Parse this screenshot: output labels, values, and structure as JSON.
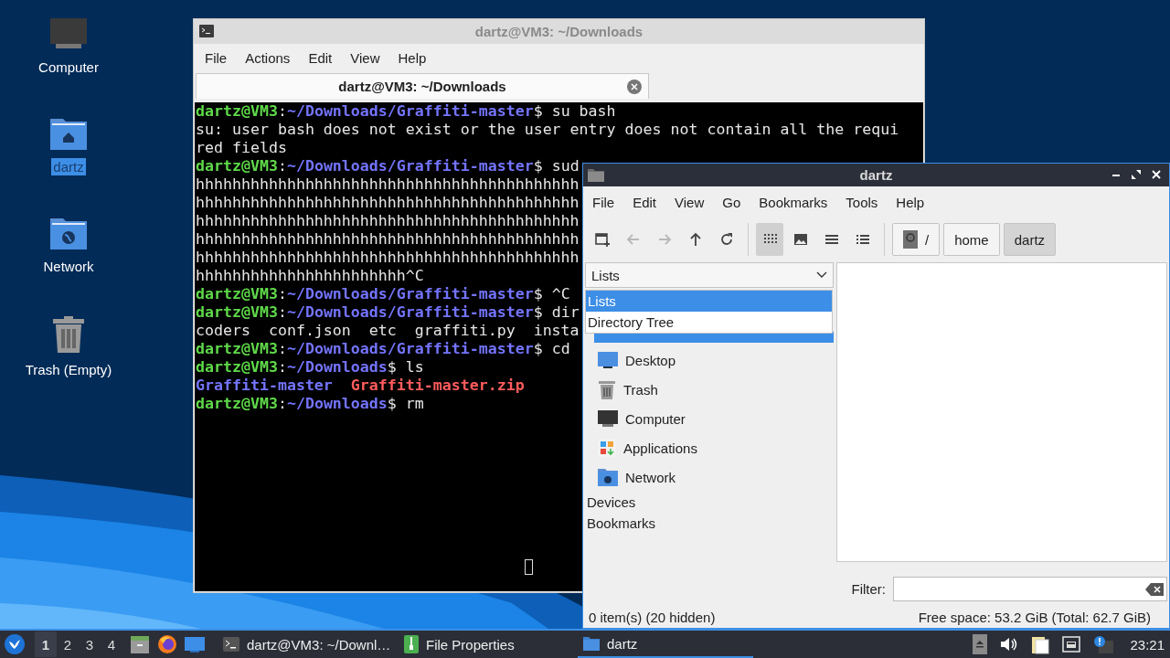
{
  "desktop_icons": [
    {
      "label": "Computer",
      "kind": "computer",
      "selected": false
    },
    {
      "label": "dartz",
      "kind": "home",
      "selected": true
    },
    {
      "label": "Network",
      "kind": "network",
      "selected": false
    },
    {
      "label": "Trash (Empty)",
      "kind": "trash",
      "selected": false
    }
  ],
  "terminal": {
    "title": "dartz@VM3: ~/Downloads",
    "active": false,
    "menu": [
      "File",
      "Actions",
      "Edit",
      "View",
      "Help"
    ],
    "tab": {
      "label": "dartz@VM3: ~/Downloads"
    },
    "lines": [
      {
        "segments": [
          {
            "kind": "user",
            "text": "dartz@VM3"
          },
          {
            "kind": "plain",
            "text": ":"
          },
          {
            "kind": "path",
            "text": "~/Downloads/Graffiti-master"
          },
          {
            "kind": "plain",
            "text": "$ su bash"
          }
        ]
      },
      {
        "segments": [
          {
            "kind": "plain",
            "text": "su: user bash does not exist or the user entry does not contain all the requi"
          }
        ]
      },
      {
        "segments": [
          {
            "kind": "plain",
            "text": "red fields"
          }
        ]
      },
      {
        "segments": [
          {
            "kind": "user",
            "text": "dartz@VM3"
          },
          {
            "kind": "plain",
            "text": ":"
          },
          {
            "kind": "path",
            "text": "~/Downloads/Graffiti-master"
          },
          {
            "kind": "plain",
            "text": "$ sud"
          }
        ]
      },
      {
        "segments": [
          {
            "kind": "plain",
            "text": "hhhhhhhhhhhhhhhhhhhhhhhhhhhhhhhhhhhhhhhhhh"
          }
        ]
      },
      {
        "segments": [
          {
            "kind": "plain",
            "text": "hhhhhhhhhhhhhhhhhhhhhhhhhhhhhhhhhhhhhhhhhh"
          }
        ]
      },
      {
        "segments": [
          {
            "kind": "plain",
            "text": "hhhhhhhhhhhhhhhhhhhhhhhhhhhhhhhhhhhhhhhhhh"
          }
        ]
      },
      {
        "segments": [
          {
            "kind": "plain",
            "text": "hhhhhhhhhhhhhhhhhhhhhhhhhhhhhhhhhhhhhhhhhh"
          }
        ]
      },
      {
        "segments": [
          {
            "kind": "plain",
            "text": "hhhhhhhhhhhhhhhhhhhhhhhhhhhhhhhhhhhhhhhhhh"
          }
        ]
      },
      {
        "segments": [
          {
            "kind": "plain",
            "text": "hhhhhhhhhhhhhhhhhhhhhhh^C"
          }
        ]
      },
      {
        "segments": [
          {
            "kind": "user",
            "text": "dartz@VM3"
          },
          {
            "kind": "plain",
            "text": ":"
          },
          {
            "kind": "path",
            "text": "~/Downloads/Graffiti-master"
          },
          {
            "kind": "plain",
            "text": "$ ^C"
          }
        ]
      },
      {
        "segments": [
          {
            "kind": "user",
            "text": "dartz@VM3"
          },
          {
            "kind": "plain",
            "text": ":"
          },
          {
            "kind": "path",
            "text": "~/Downloads/Graffiti-master"
          },
          {
            "kind": "plain",
            "text": "$ dir"
          }
        ]
      },
      {
        "segments": [
          {
            "kind": "plain",
            "text": "coders  conf.json  etc  graffiti.py  insta"
          }
        ]
      },
      {
        "segments": [
          {
            "kind": "user",
            "text": "dartz@VM3"
          },
          {
            "kind": "plain",
            "text": ":"
          },
          {
            "kind": "path",
            "text": "~/Downloads/Graffiti-master"
          },
          {
            "kind": "plain",
            "text": "$ cd"
          }
        ]
      },
      {
        "segments": [
          {
            "kind": "user",
            "text": "dartz@VM3"
          },
          {
            "kind": "plain",
            "text": ":"
          },
          {
            "kind": "path",
            "text": "~/Downloads"
          },
          {
            "kind": "plain",
            "text": "$ ls"
          }
        ]
      },
      {
        "segments": [
          {
            "kind": "directory",
            "text": "Graffiti-master"
          },
          {
            "kind": "archive",
            "text": "  Graffiti-master.zip"
          }
        ]
      },
      {
        "segments": [
          {
            "kind": "user",
            "text": "dartz@VM3"
          },
          {
            "kind": "plain",
            "text": ":"
          },
          {
            "kind": "path",
            "text": "~/Downloads"
          },
          {
            "kind": "plain",
            "text": "$ rm"
          }
        ]
      }
    ]
  },
  "file_manager": {
    "title": "dartz",
    "active": true,
    "menu": [
      "File",
      "Edit",
      "View",
      "Go",
      "Bookmarks",
      "Tools",
      "Help"
    ],
    "toolbar": [
      {
        "kind": "new-tab",
        "disabled": false
      },
      {
        "kind": "back",
        "disabled": true
      },
      {
        "kind": "forward",
        "disabled": true
      },
      {
        "kind": "up",
        "disabled": false
      },
      {
        "kind": "reload",
        "disabled": false
      }
    ],
    "view_modes": [
      {
        "kind": "icons",
        "selected": true
      },
      {
        "kind": "thumbnails",
        "selected": false
      },
      {
        "kind": "compact",
        "selected": false
      },
      {
        "kind": "details",
        "selected": false
      }
    ],
    "path_buttons": [
      {
        "kind": "root",
        "label": "/",
        "selected": false
      },
      {
        "kind": "folder",
        "label": "home",
        "selected": false
      },
      {
        "kind": "folder",
        "label": "dartz",
        "selected": true
      }
    ],
    "side_pane": {
      "combo": {
        "value": "Lists"
      },
      "dropdown": [
        {
          "label": "Lists",
          "selected": true
        },
        {
          "label": "Directory Tree",
          "selected": false
        }
      ],
      "places": [
        {
          "label": "Desktop",
          "kind": "desktop"
        },
        {
          "label": "Trash",
          "kind": "trash"
        },
        {
          "label": "Computer",
          "kind": "computer"
        },
        {
          "label": "Applications",
          "kind": "applications"
        },
        {
          "label": "Network",
          "kind": "network"
        }
      ],
      "sections": [
        "Devices",
        "Bookmarks"
      ]
    },
    "filter": {
      "label": "Filter:"
    },
    "status_bar": {
      "items": "0 item(s) (20 hidden)",
      "free_space": "Free space: 53.2 GiB (Total: 62.7 GiB)"
    }
  },
  "taskbar": {
    "workspaces": [
      {
        "label": "1",
        "selected": true
      },
      {
        "label": "2",
        "selected": false
      },
      {
        "label": "3",
        "selected": false
      },
      {
        "label": "4",
        "selected": false
      }
    ],
    "tasks": [
      {
        "label": "dartz@VM3: ~/Downl…",
        "kind": "terminal",
        "selected": false
      },
      {
        "label": "File Properties",
        "kind": "archive",
        "selected": false
      },
      {
        "label": "dartz",
        "kind": "folder",
        "selected": true
      }
    ],
    "clock": "23:21"
  }
}
